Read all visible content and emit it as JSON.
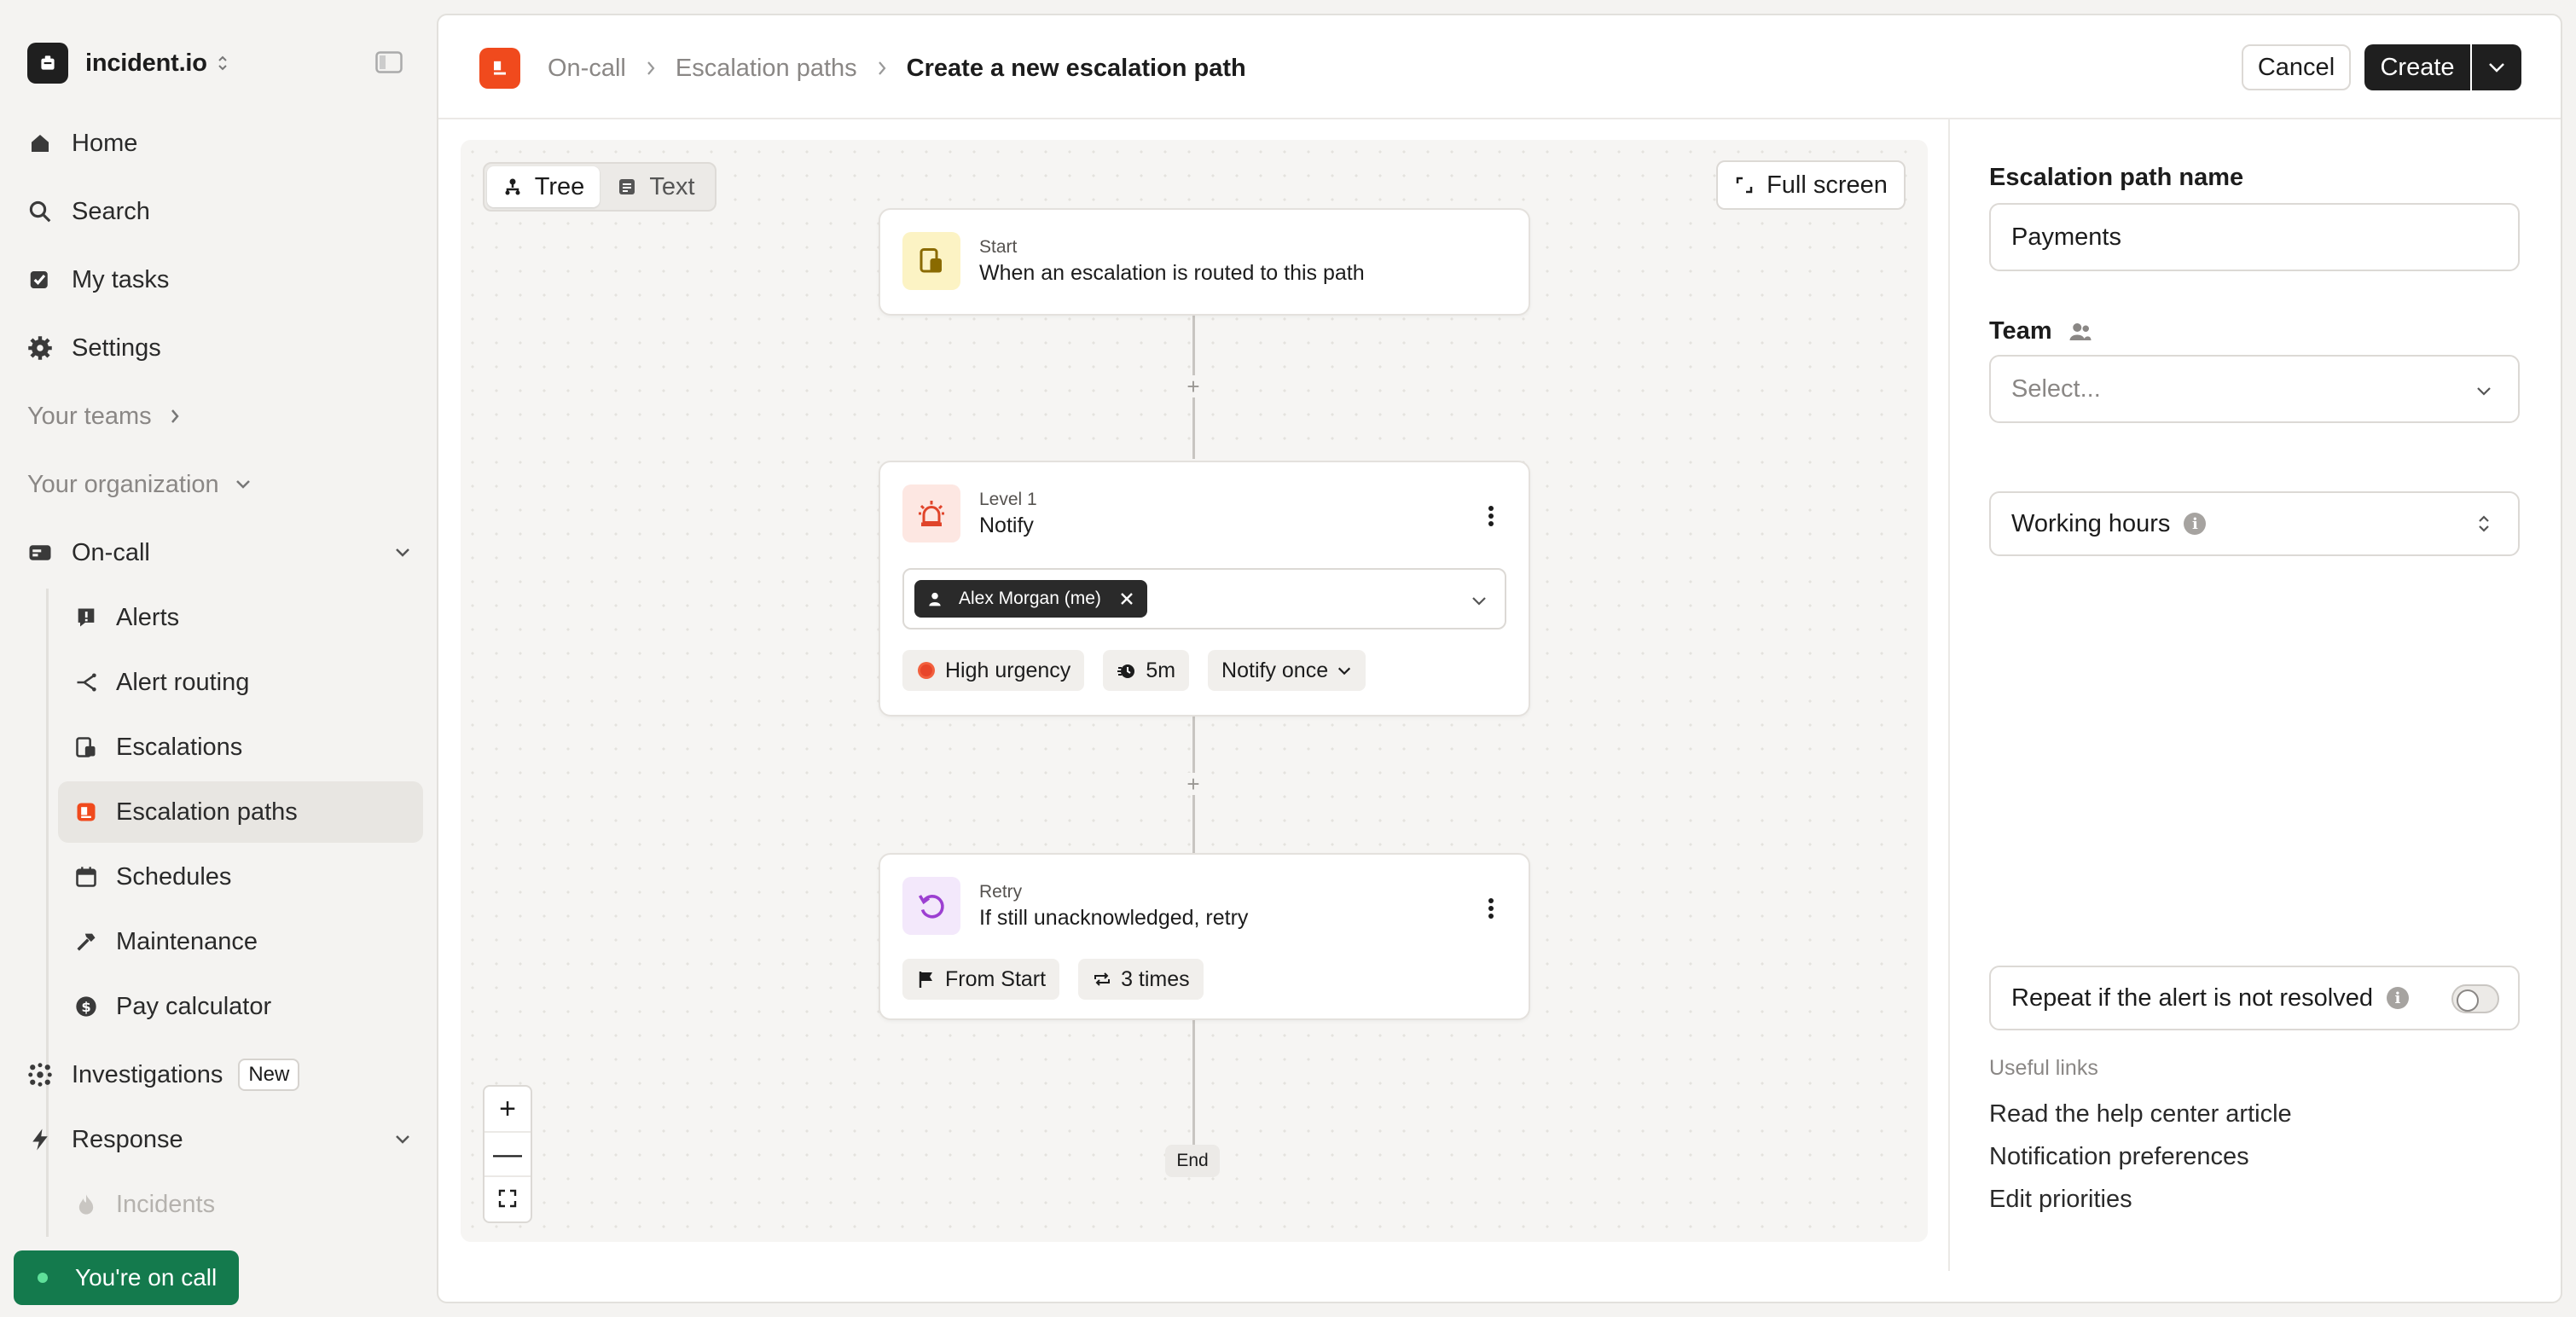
{
  "org": {
    "name": "incident.io"
  },
  "nav": {
    "home": "Home",
    "search": "Search",
    "my_tasks": "My tasks",
    "settings": "Settings",
    "your_teams": "Your teams",
    "your_organization": "Your organization",
    "on_call": "On-call",
    "on_call_items": [
      "Alerts",
      "Alert routing",
      "Escalations",
      "Escalation paths",
      "Schedules",
      "Maintenance",
      "Pay calculator"
    ],
    "investigations": "Investigations",
    "investigations_badge": "New",
    "response": "Response",
    "response_items": [
      "Incidents"
    ],
    "oncall_status": "You're on call"
  },
  "breadcrumb": {
    "items": [
      "On-call",
      "Escalation paths"
    ],
    "current": "Create a new escalation path"
  },
  "actions": {
    "cancel": "Cancel",
    "create": "Create"
  },
  "canvas": {
    "view_tabs": [
      "Tree",
      "Text"
    ],
    "active_tab": "Tree",
    "fullscreen": "Full screen",
    "start_node": {
      "kicker": "Start",
      "title": "When an escalation is routed to this path"
    },
    "level_node": {
      "kicker": "Level 1",
      "title": "Notify",
      "assignee": "Alex Morgan (me)",
      "urgency": "High urgency",
      "delay": "5m",
      "notify_mode": "Notify once"
    },
    "retry_node": {
      "kicker": "Retry",
      "title": "If still unacknowledged, retry",
      "from": "From Start",
      "times": "3 times"
    },
    "end_label": "End",
    "zoom": {
      "in": "+",
      "out": "—"
    }
  },
  "form": {
    "name_label": "Escalation path name",
    "name_value": "Payments",
    "team_label": "Team",
    "team_placeholder": "Select...",
    "working_hours": "Working hours",
    "repeat_label": "Repeat if the alert is not resolved",
    "repeat_enabled": false,
    "useful_links_label": "Useful links",
    "links": [
      "Read the help center article",
      "Notification preferences",
      "Edit priorities"
    ]
  },
  "colors": {
    "brand": "#f04a1d",
    "oncall": "#147a4d",
    "dark": "#1f1f1f"
  }
}
